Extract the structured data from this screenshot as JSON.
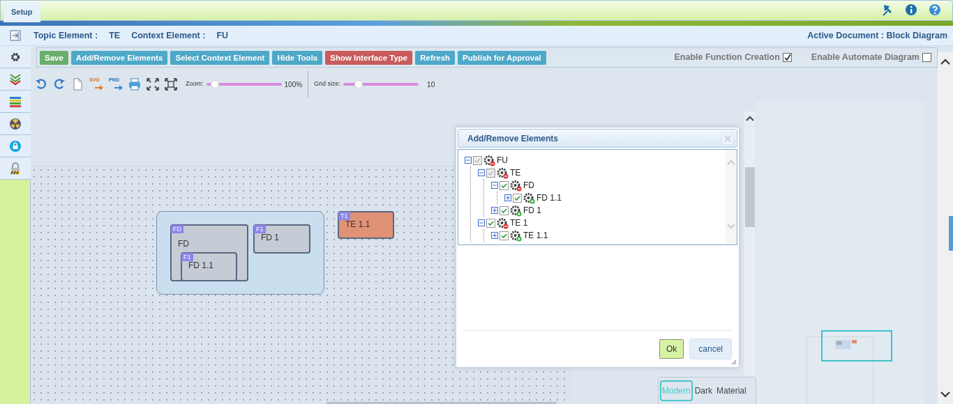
{
  "tab": {
    "label": "Setup",
    "selected": true
  },
  "header": {
    "topic_label": "Topic Element :",
    "topic": "TE",
    "context_label": "Context Element :",
    "context": "FU",
    "active_document": "Active Document : Block Diagram"
  },
  "toolbar": [
    {
      "label": "Save",
      "kind": "success"
    },
    {
      "label": "Add/Remove Elements",
      "kind": "info"
    },
    {
      "label": "Select Context Element",
      "kind": "info"
    },
    {
      "label": "Hide Tools",
      "kind": "info"
    },
    {
      "label": "Show Interface Type",
      "kind": "danger"
    },
    {
      "label": "Refresh",
      "kind": "info"
    },
    {
      "label": "Publish for Approval",
      "kind": "info"
    }
  ],
  "options": [
    {
      "label": "Enable Function Creation",
      "checked": true
    },
    {
      "label": "Enable Automate Diagram",
      "checked": false
    }
  ],
  "tools": [
    {
      "kind": "undo"
    },
    {
      "kind": "redo"
    },
    {
      "kind": "page"
    },
    {
      "kind": "export",
      "label": "SVG"
    },
    {
      "kind": "export",
      "label": "PNG"
    },
    {
      "kind": "print"
    },
    {
      "kind": "fit"
    },
    {
      "kind": "fullscreen"
    }
  ],
  "sliders": [
    {
      "label": "Zoom:",
      "level": 0.12,
      "reading": "100%"
    },
    {
      "label": "Grid size:",
      "level": 0.2,
      "reading": "10"
    }
  ],
  "diagram": [
    {
      "kind": "group",
      "color": "#c9deee"
    },
    {
      "kind": "block",
      "tag": "FD",
      "label": "FD",
      "color": "#c6ccd6"
    },
    {
      "kind": "block",
      "tag": "F1",
      "label": "FD 1.1",
      "color": "#c6ccd6"
    },
    {
      "kind": "block",
      "tag": "F1",
      "label": "FD 1",
      "color": "#c6ccd6"
    },
    {
      "kind": "block",
      "tag": "T1",
      "label": "TE 1.1",
      "color": "#e09276"
    }
  ],
  "dialog": {
    "title": "Add/Remove Elements",
    "tree": [
      {
        "label": "FU",
        "checked": true,
        "disabled": true,
        "expanded": true,
        "children": [
          {
            "label": "TE",
            "checked": true,
            "disabled": true,
            "expanded": true,
            "children": [
              {
                "label": "FD",
                "checked": true,
                "disabled": false,
                "expanded": true,
                "children": [
                  {
                    "label": "FD 1.1",
                    "checked": true,
                    "disabled": false,
                    "expanded": false
                  }
                ]
              },
              {
                "label": "FD 1",
                "checked": true,
                "disabled": false,
                "expanded": false
              }
            ]
          },
          {
            "label": "TE 1",
            "checked": true,
            "disabled": false,
            "expanded": true,
            "children": [
              {
                "label": "TE 1.1",
                "checked": true,
                "disabled": false,
                "expanded": false
              }
            ]
          }
        ]
      }
    ],
    "buttons": [
      {
        "label": "Ok",
        "kind": "primary"
      },
      {
        "label": "cancel",
        "kind": "secondary"
      }
    ]
  },
  "themes": [
    {
      "label": "Modern",
      "selected": true
    },
    {
      "label": "Dark",
      "selected": false
    },
    {
      "label": "Material",
      "selected": false
    }
  ]
}
